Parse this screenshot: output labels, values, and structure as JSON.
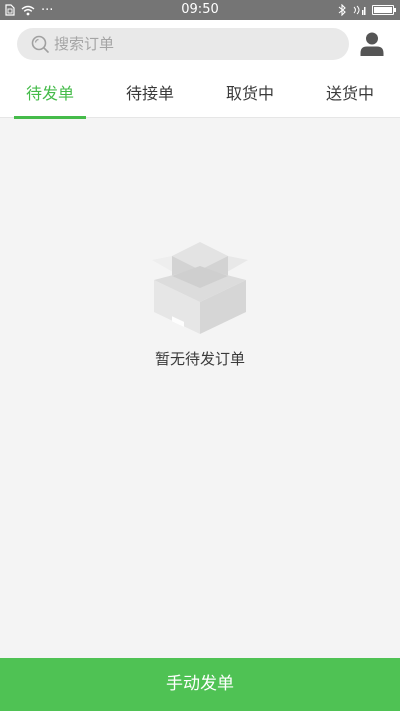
{
  "status_bar": {
    "time": "09:50",
    "dots": "···",
    "accent_color": "#757575"
  },
  "search": {
    "placeholder": "搜索订单",
    "value": ""
  },
  "tabs": [
    {
      "label": "待发单",
      "active": true
    },
    {
      "label": "待接单",
      "active": false
    },
    {
      "label": "取货中",
      "active": false
    },
    {
      "label": "送货中",
      "active": false
    }
  ],
  "empty_state": {
    "message": "暂无待发订单",
    "icon": "empty-box-icon"
  },
  "bottom_action": {
    "label": "手动发单"
  },
  "colors": {
    "accent": "#45bb4a",
    "button": "#4fc254",
    "background": "#f4f4f4"
  }
}
